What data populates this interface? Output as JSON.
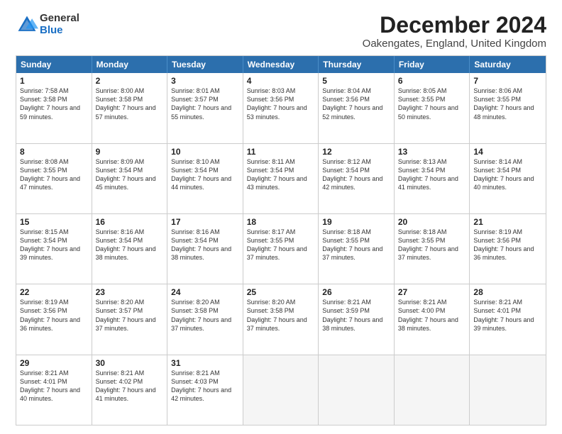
{
  "logo": {
    "general": "General",
    "blue": "Blue"
  },
  "title": "December 2024",
  "subtitle": "Oakengates, England, United Kingdom",
  "days": [
    "Sunday",
    "Monday",
    "Tuesday",
    "Wednesday",
    "Thursday",
    "Friday",
    "Saturday"
  ],
  "weeks": [
    [
      {
        "day": "1",
        "sunrise": "Sunrise: 7:58 AM",
        "sunset": "Sunset: 3:58 PM",
        "daylight": "Daylight: 7 hours and 59 minutes."
      },
      {
        "day": "2",
        "sunrise": "Sunrise: 8:00 AM",
        "sunset": "Sunset: 3:58 PM",
        "daylight": "Daylight: 7 hours and 57 minutes."
      },
      {
        "day": "3",
        "sunrise": "Sunrise: 8:01 AM",
        "sunset": "Sunset: 3:57 PM",
        "daylight": "Daylight: 7 hours and 55 minutes."
      },
      {
        "day": "4",
        "sunrise": "Sunrise: 8:03 AM",
        "sunset": "Sunset: 3:56 PM",
        "daylight": "Daylight: 7 hours and 53 minutes."
      },
      {
        "day": "5",
        "sunrise": "Sunrise: 8:04 AM",
        "sunset": "Sunset: 3:56 PM",
        "daylight": "Daylight: 7 hours and 52 minutes."
      },
      {
        "day": "6",
        "sunrise": "Sunrise: 8:05 AM",
        "sunset": "Sunset: 3:55 PM",
        "daylight": "Daylight: 7 hours and 50 minutes."
      },
      {
        "day": "7",
        "sunrise": "Sunrise: 8:06 AM",
        "sunset": "Sunset: 3:55 PM",
        "daylight": "Daylight: 7 hours and 48 minutes."
      }
    ],
    [
      {
        "day": "8",
        "sunrise": "Sunrise: 8:08 AM",
        "sunset": "Sunset: 3:55 PM",
        "daylight": "Daylight: 7 hours and 47 minutes."
      },
      {
        "day": "9",
        "sunrise": "Sunrise: 8:09 AM",
        "sunset": "Sunset: 3:54 PM",
        "daylight": "Daylight: 7 hours and 45 minutes."
      },
      {
        "day": "10",
        "sunrise": "Sunrise: 8:10 AM",
        "sunset": "Sunset: 3:54 PM",
        "daylight": "Daylight: 7 hours and 44 minutes."
      },
      {
        "day": "11",
        "sunrise": "Sunrise: 8:11 AM",
        "sunset": "Sunset: 3:54 PM",
        "daylight": "Daylight: 7 hours and 43 minutes."
      },
      {
        "day": "12",
        "sunrise": "Sunrise: 8:12 AM",
        "sunset": "Sunset: 3:54 PM",
        "daylight": "Daylight: 7 hours and 42 minutes."
      },
      {
        "day": "13",
        "sunrise": "Sunrise: 8:13 AM",
        "sunset": "Sunset: 3:54 PM",
        "daylight": "Daylight: 7 hours and 41 minutes."
      },
      {
        "day": "14",
        "sunrise": "Sunrise: 8:14 AM",
        "sunset": "Sunset: 3:54 PM",
        "daylight": "Daylight: 7 hours and 40 minutes."
      }
    ],
    [
      {
        "day": "15",
        "sunrise": "Sunrise: 8:15 AM",
        "sunset": "Sunset: 3:54 PM",
        "daylight": "Daylight: 7 hours and 39 minutes."
      },
      {
        "day": "16",
        "sunrise": "Sunrise: 8:16 AM",
        "sunset": "Sunset: 3:54 PM",
        "daylight": "Daylight: 7 hours and 38 minutes."
      },
      {
        "day": "17",
        "sunrise": "Sunrise: 8:16 AM",
        "sunset": "Sunset: 3:54 PM",
        "daylight": "Daylight: 7 hours and 38 minutes."
      },
      {
        "day": "18",
        "sunrise": "Sunrise: 8:17 AM",
        "sunset": "Sunset: 3:55 PM",
        "daylight": "Daylight: 7 hours and 37 minutes."
      },
      {
        "day": "19",
        "sunrise": "Sunrise: 8:18 AM",
        "sunset": "Sunset: 3:55 PM",
        "daylight": "Daylight: 7 hours and 37 minutes."
      },
      {
        "day": "20",
        "sunrise": "Sunrise: 8:18 AM",
        "sunset": "Sunset: 3:55 PM",
        "daylight": "Daylight: 7 hours and 37 minutes."
      },
      {
        "day": "21",
        "sunrise": "Sunrise: 8:19 AM",
        "sunset": "Sunset: 3:56 PM",
        "daylight": "Daylight: 7 hours and 36 minutes."
      }
    ],
    [
      {
        "day": "22",
        "sunrise": "Sunrise: 8:19 AM",
        "sunset": "Sunset: 3:56 PM",
        "daylight": "Daylight: 7 hours and 36 minutes."
      },
      {
        "day": "23",
        "sunrise": "Sunrise: 8:20 AM",
        "sunset": "Sunset: 3:57 PM",
        "daylight": "Daylight: 7 hours and 37 minutes."
      },
      {
        "day": "24",
        "sunrise": "Sunrise: 8:20 AM",
        "sunset": "Sunset: 3:58 PM",
        "daylight": "Daylight: 7 hours and 37 minutes."
      },
      {
        "day": "25",
        "sunrise": "Sunrise: 8:20 AM",
        "sunset": "Sunset: 3:58 PM",
        "daylight": "Daylight: 7 hours and 37 minutes."
      },
      {
        "day": "26",
        "sunrise": "Sunrise: 8:21 AM",
        "sunset": "Sunset: 3:59 PM",
        "daylight": "Daylight: 7 hours and 38 minutes."
      },
      {
        "day": "27",
        "sunrise": "Sunrise: 8:21 AM",
        "sunset": "Sunset: 4:00 PM",
        "daylight": "Daylight: 7 hours and 38 minutes."
      },
      {
        "day": "28",
        "sunrise": "Sunrise: 8:21 AM",
        "sunset": "Sunset: 4:01 PM",
        "daylight": "Daylight: 7 hours and 39 minutes."
      }
    ],
    [
      {
        "day": "29",
        "sunrise": "Sunrise: 8:21 AM",
        "sunset": "Sunset: 4:01 PM",
        "daylight": "Daylight: 7 hours and 40 minutes."
      },
      {
        "day": "30",
        "sunrise": "Sunrise: 8:21 AM",
        "sunset": "Sunset: 4:02 PM",
        "daylight": "Daylight: 7 hours and 41 minutes."
      },
      {
        "day": "31",
        "sunrise": "Sunrise: 8:21 AM",
        "sunset": "Sunset: 4:03 PM",
        "daylight": "Daylight: 7 hours and 42 minutes."
      },
      null,
      null,
      null,
      null
    ]
  ]
}
